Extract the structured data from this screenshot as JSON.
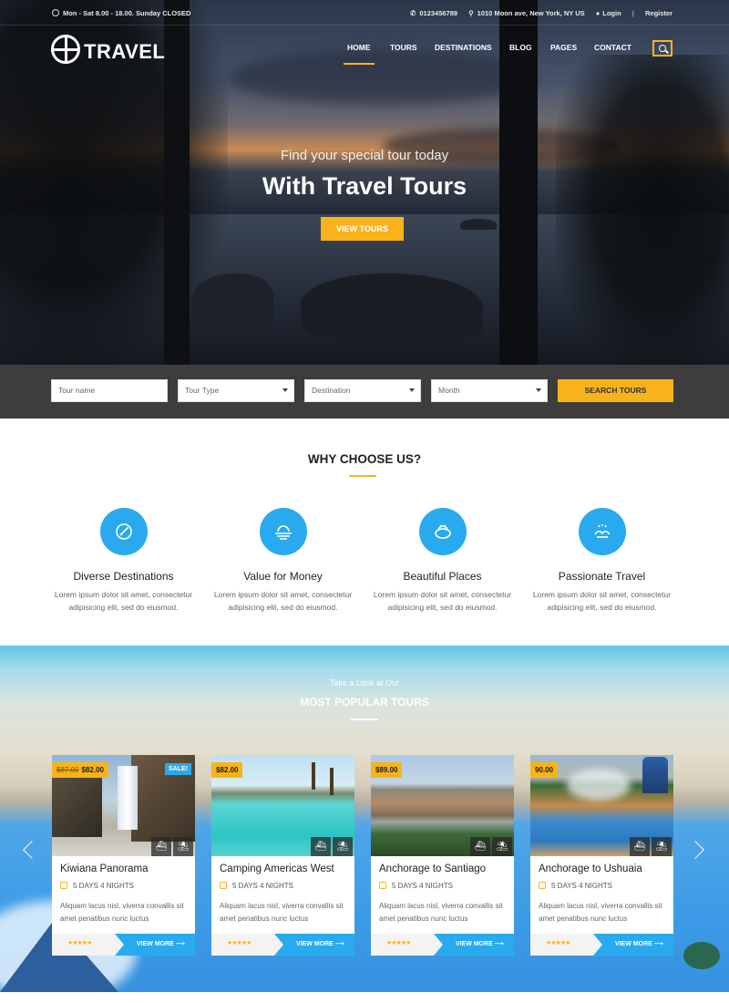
{
  "topbar": {
    "hours": "Mon - Sat 8.00 - 18.00. Sunday CLOSED",
    "phone": "0123456789",
    "address": "1010 Moon ave, New York, NY US",
    "login": "Login",
    "register": "Register"
  },
  "logo": {
    "text": "TRAVEL"
  },
  "nav": {
    "items": [
      "HOME",
      "TOURS",
      "DESTINATIONS",
      "BLOG",
      "PAGES",
      "CONTACT"
    ],
    "active": "HOME"
  },
  "hero": {
    "subtitle": "Find your special tour today",
    "title": "With Travel Tours",
    "button": "VIEW TOURS"
  },
  "search": {
    "tour_name_placeholder": "Tour name",
    "tour_type": "Tour Type",
    "destination": "Destination",
    "month": "Month",
    "button": "SEARCH TOURS"
  },
  "why": {
    "title": "WHY CHOOSE US?",
    "features": [
      {
        "icon": "compass-icon",
        "title": "Diverse Destinations",
        "desc": "Lorem ipsum dolor sit amet, consectetur adipisicing elit, sed do eiusmod."
      },
      {
        "icon": "sunset-icon",
        "title": "Value for Money",
        "desc": "Lorem ipsum dolor sit amet, consectetur adipisicing elit, sed do eiusmod."
      },
      {
        "icon": "basket-icon",
        "title": "Beautiful Places",
        "desc": "Lorem ipsum dolor sit amet, consectetur adipisicing elit, sed do eiusmod."
      },
      {
        "icon": "hands-icon",
        "title": "Passionate Travel",
        "desc": "Lorem ipsum dolor sit amet, consectetur adipisicing elit, sed do eiusmod."
      }
    ]
  },
  "popular": {
    "subtitle": "Take a Look at Our",
    "title": "MOST POPULAR TOURS",
    "tours": [
      {
        "old_price": "$87.00",
        "price": "$82.00",
        "sale": "SALE!",
        "title": "Kiwiana Panorama",
        "duration": "5 DAYS 4 NIGHTS",
        "desc": "Aliquam lacus nisl, viverra convallis sit amet penatibus nunc luctus",
        "stars": "★★★★★",
        "button": "VIEW MORE"
      },
      {
        "old_price": "",
        "price": "$82.00",
        "sale": "",
        "title": "Camping Americas West",
        "duration": "5 DAYS 4 NIGHTS",
        "desc": "Aliquam lacus nisl, viverra convallis sit amet penatibus nunc luctus",
        "stars": "★★★★★",
        "button": "VIEW MORE"
      },
      {
        "old_price": "",
        "price": "$89.00",
        "sale": "",
        "title": "Anchorage to Santiago",
        "duration": "5 DAYS 4 NIGHTS",
        "desc": "Aliquam lacus nisl, viverra convallis sit amet penatibus nunc luctus",
        "stars": "★★★★★",
        "button": "VIEW MORE"
      },
      {
        "old_price": "",
        "price": "90.00",
        "sale": "",
        "title": "Anchorage to Ushuaia",
        "duration": "5 DAYS 4 NIGHTS",
        "desc": "Aliquam lacus nisl, viverra convallis sit amet penatibus nunc luctus",
        "stars": "★★★★★",
        "button": "VIEW MORE"
      }
    ]
  },
  "colors": {
    "accent": "#f9b31a",
    "blue": "#29aaee",
    "dark_bar": "#373737"
  }
}
